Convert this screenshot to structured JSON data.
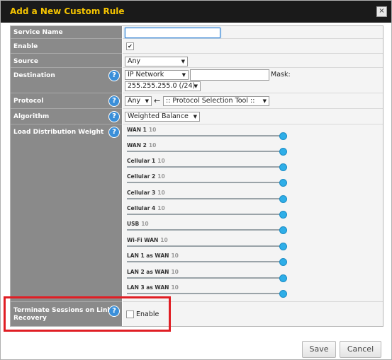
{
  "dialog": {
    "title": "Add a New Custom Rule",
    "close_glyph": "×"
  },
  "rows": {
    "service_name": {
      "label": "Service Name",
      "value": ""
    },
    "enable": {
      "label": "Enable",
      "checked_glyph": "✔"
    },
    "source": {
      "label": "Source",
      "selected": "Any"
    },
    "destination": {
      "label": "Destination",
      "type_selected": "IP Network",
      "ip_value": "",
      "mask_label": "Mask:",
      "mask_selected": "255.255.255.0 (/24)"
    },
    "protocol": {
      "label": "Protocol",
      "selected": "Any",
      "arrow_glyph": "←",
      "tool_selected": ":: Protocol Selection Tool ::"
    },
    "algorithm": {
      "label": "Algorithm",
      "selected": "Weighted Balance"
    },
    "load_distribution": {
      "label": "Load Distribution Weight",
      "weights": [
        {
          "name": "WAN 1",
          "value": "10"
        },
        {
          "name": "WAN 2",
          "value": "10"
        },
        {
          "name": "Cellular 1",
          "value": "10"
        },
        {
          "name": "Cellular 2",
          "value": "10"
        },
        {
          "name": "Cellular 3",
          "value": "10"
        },
        {
          "name": "Cellular 4",
          "value": "10"
        },
        {
          "name": "USB",
          "value": "10"
        },
        {
          "name": "Wi-Fi WAN",
          "value": "10"
        },
        {
          "name": "LAN 1 as WAN",
          "value": "10"
        },
        {
          "name": "LAN 2 as WAN",
          "value": "10"
        },
        {
          "name": "LAN 3 as WAN",
          "value": "10"
        }
      ]
    },
    "terminate": {
      "label_line1": "Terminate Sessions on Link",
      "label_line2": "Recovery",
      "checkbox_label": "Enable"
    }
  },
  "help_glyph": "?",
  "dropdown_glyph": "▼",
  "buttons": {
    "save": "Save",
    "cancel": "Cancel"
  },
  "colors": {
    "title_bar": "#1a1a1a",
    "title_text": "#f5c400",
    "label_column": "#8a8a8a",
    "help_icon": "#3a8fd9",
    "slider_knob": "#2eaee8",
    "highlight_box": "#e01e24"
  }
}
